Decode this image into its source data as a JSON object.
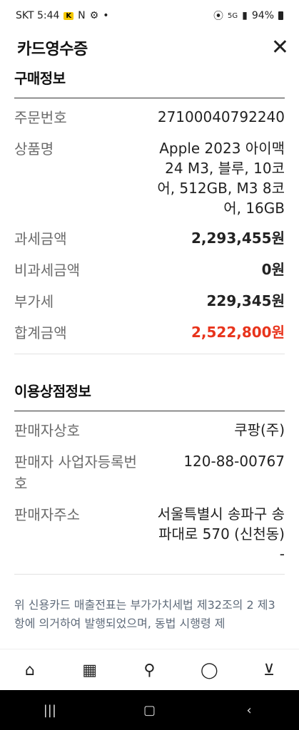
{
  "status_bar": {
    "carrier_time": "SKT 5:44",
    "badge": "K",
    "network": "5G",
    "battery": "94%"
  },
  "header": {
    "title": "카드영수증"
  },
  "purchase": {
    "section_title": "구매정보",
    "rows": [
      {
        "label": "주문번호",
        "value": "27100040792240"
      },
      {
        "label": "상품명",
        "value": "Apple 2023 아이맥 24 M3, 블루, 10코어, 512GB, M3 8코어, 16GB"
      },
      {
        "label": "과세금액",
        "value": "2,293,455원"
      },
      {
        "label": "비과세금액",
        "value": "0원"
      },
      {
        "label": "부가세",
        "value": "229,345원"
      },
      {
        "label": "합계금액",
        "value": "2,522,800원"
      }
    ]
  },
  "store": {
    "section_title": "이용상점정보",
    "rows": [
      {
        "label": "판매자상호",
        "value": "쿠팡(주)"
      },
      {
        "label": "판매자 사업자등록번호",
        "value": "120-88-00767"
      },
      {
        "label": "판매자주소",
        "value": "서울특별시 송파구 송파대로 570 (신천동) -"
      }
    ]
  },
  "notice": "위 신용카드 매출전표는 부가가치세법 제32조의 2 제3항에 의거하여 발행되었으며, 동법 시행령 제",
  "bottom_nav": {
    "icons": [
      "home-icon",
      "grid-icon",
      "search-icon",
      "user-icon",
      "cart-icon"
    ]
  },
  "colors": {
    "accent_red": "#e8341c"
  }
}
